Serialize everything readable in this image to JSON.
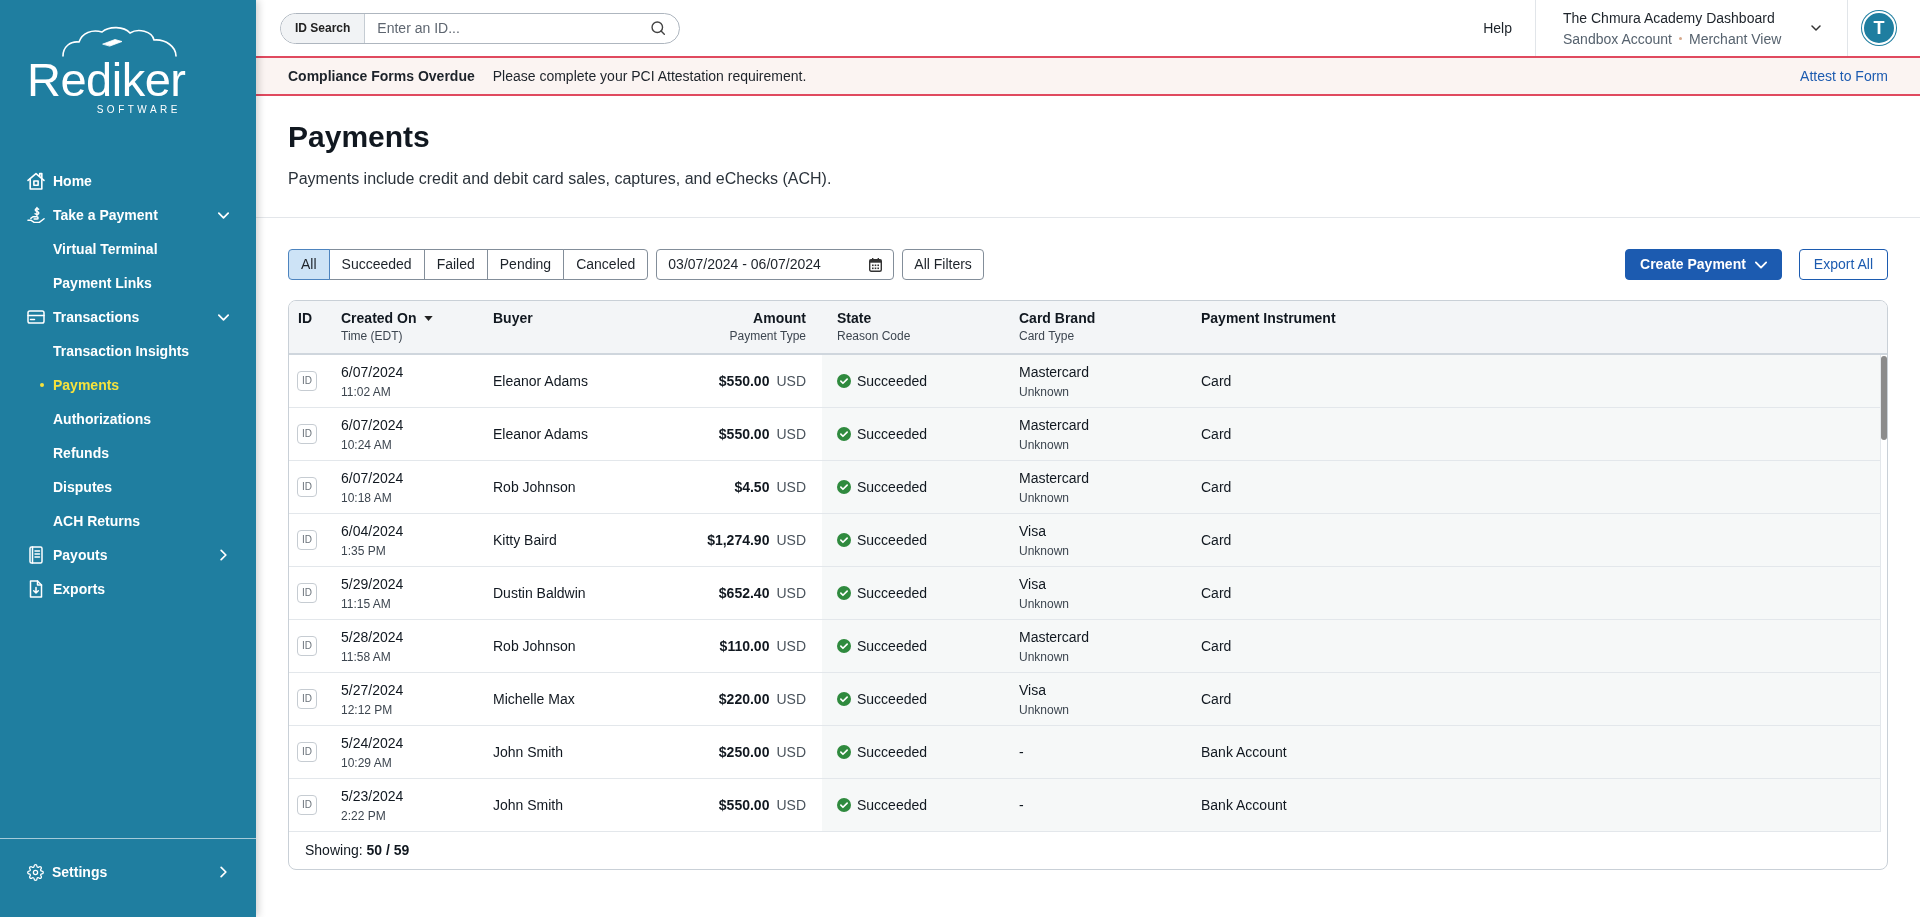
{
  "sidebar": {
    "logo": {
      "wordmark": "Rediker",
      "tagline": "SOFTWARE"
    },
    "nav": [
      {
        "label": "Home",
        "selected": false
      },
      {
        "label": "Take a Payment",
        "selected": false,
        "expanded": true,
        "children": [
          {
            "label": "Virtual Terminal",
            "selected": false
          },
          {
            "label": "Payment Links",
            "selected": false
          }
        ]
      },
      {
        "label": "Transactions",
        "selected": false,
        "expanded": true,
        "children": [
          {
            "label": "Transaction Insights",
            "selected": false
          },
          {
            "label": "Payments",
            "selected": true
          },
          {
            "label": "Authorizations",
            "selected": false
          },
          {
            "label": "Refunds",
            "selected": false
          },
          {
            "label": "Disputes",
            "selected": false
          },
          {
            "label": "ACH Returns",
            "selected": false
          }
        ]
      },
      {
        "label": "Payouts",
        "selected": false,
        "expanded": false
      },
      {
        "label": "Exports",
        "selected": false
      }
    ],
    "footer_nav": [
      {
        "label": "Settings",
        "selected": false,
        "expanded": false
      }
    ]
  },
  "top_bar": {
    "id_search": {
      "label": "ID Search",
      "placeholder": "Enter an ID..."
    },
    "help": "Help",
    "account": {
      "title": "The Chmura Academy Dashboard",
      "account_type": "Sandbox Account",
      "view": "Merchant View"
    },
    "avatar": "T"
  },
  "alert_banner": {
    "title": "Compliance Forms Overdue",
    "message": "Please complete your PCI Attestation requirement.",
    "link": "Attest to Form"
  },
  "page": {
    "title": "Payments",
    "description": "Payments include credit and debit card sales, captures, and eChecks (ACH)."
  },
  "filters": {
    "tabs": [
      {
        "label": "All",
        "selected": true
      },
      {
        "label": "Succeeded",
        "selected": false
      },
      {
        "label": "Failed",
        "selected": false
      },
      {
        "label": "Pending",
        "selected": false
      },
      {
        "label": "Canceled",
        "selected": false
      }
    ],
    "date_range": {
      "value": "03/07/2024 - 06/07/2024"
    },
    "more_filters": "All Filters"
  },
  "actions": [
    {
      "label": "Create Payment",
      "kind": "primary",
      "dropdown": true
    },
    {
      "label": "Export All",
      "kind": "secondary",
      "dropdown": false
    }
  ],
  "table": {
    "columns": [
      {
        "label": "ID",
        "kind": "text",
        "sorted": false
      },
      {
        "label": "Created On",
        "sublabel": "Time (EDT)",
        "kind": "text",
        "sorted": true
      },
      {
        "label": "Buyer",
        "kind": "text",
        "sorted": false
      },
      {
        "label": "Amount",
        "sublabel": "Payment Type",
        "kind": "amount",
        "sorted": false
      },
      {
        "label": "State",
        "sublabel": "Reason Code",
        "kind": "text",
        "sorted": false
      },
      {
        "label": "Card Brand",
        "sublabel": "Card Type",
        "kind": "text",
        "sorted": false
      },
      {
        "label": "Payment Instrument",
        "kind": "text",
        "sorted": false
      }
    ],
    "rows": [
      {
        "id_label": "ID",
        "date": "6/07/2024",
        "time": "11:02 AM",
        "buyer": "Eleanor Adams",
        "amount": "$550.00",
        "currency": "USD",
        "state": "Succeeded",
        "card_brand": "Mastercard",
        "card_type": "Unknown",
        "instrument": "Card"
      },
      {
        "id_label": "ID",
        "date": "6/07/2024",
        "time": "10:24 AM",
        "buyer": "Eleanor Adams",
        "amount": "$550.00",
        "currency": "USD",
        "state": "Succeeded",
        "card_brand": "Mastercard",
        "card_type": "Unknown",
        "instrument": "Card"
      },
      {
        "id_label": "ID",
        "date": "6/07/2024",
        "time": "10:18 AM",
        "buyer": "Rob Johnson",
        "amount": "$4.50",
        "currency": "USD",
        "state": "Succeeded",
        "card_brand": "Mastercard",
        "card_type": "Unknown",
        "instrument": "Card"
      },
      {
        "id_label": "ID",
        "date": "6/04/2024",
        "time": "1:35 PM",
        "buyer": "Kitty Baird",
        "amount": "$1,274.90",
        "currency": "USD",
        "state": "Succeeded",
        "card_brand": "Visa",
        "card_type": "Unknown",
        "instrument": "Card"
      },
      {
        "id_label": "ID",
        "date": "5/29/2024",
        "time": "11:15 AM",
        "buyer": "Dustin Baldwin",
        "amount": "$652.40",
        "currency": "USD",
        "state": "Succeeded",
        "card_brand": "Visa",
        "card_type": "Unknown",
        "instrument": "Card"
      },
      {
        "id_label": "ID",
        "date": "5/28/2024",
        "time": "11:58 AM",
        "buyer": "Rob Johnson",
        "amount": "$110.00",
        "currency": "USD",
        "state": "Succeeded",
        "card_brand": "Mastercard",
        "card_type": "Unknown",
        "instrument": "Card"
      },
      {
        "id_label": "ID",
        "date": "5/27/2024",
        "time": "12:12 PM",
        "buyer": "Michelle Max",
        "amount": "$220.00",
        "currency": "USD",
        "state": "Succeeded",
        "card_brand": "Visa",
        "card_type": "Unknown",
        "instrument": "Card"
      },
      {
        "id_label": "ID",
        "date": "5/24/2024",
        "time": "10:29 AM",
        "buyer": "John Smith",
        "amount": "$250.00",
        "currency": "USD",
        "state": "Succeeded",
        "card_brand": "-",
        "instrument": "Bank Account"
      },
      {
        "id_label": "ID",
        "date": "5/23/2024",
        "time": "2:22 PM",
        "buyer": "John Smith",
        "amount": "$550.00",
        "currency": "USD",
        "state": "Succeeded",
        "card_brand": "-",
        "instrument": "Bank Account"
      }
    ],
    "footer": "Showing: **50 / 59**"
  }
}
